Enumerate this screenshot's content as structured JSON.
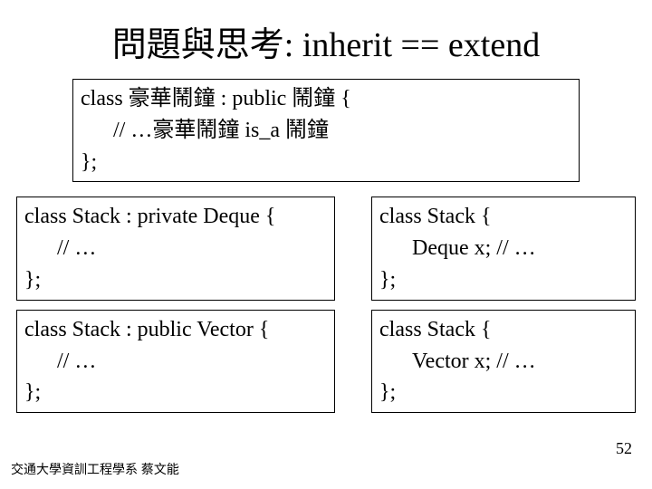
{
  "title": "問題與思考:  inherit == extend",
  "box1": {
    "l1": "class 豪華鬧鐘 : public 鬧鐘 {",
    "l2": "// …豪華鬧鐘   is_a 鬧鐘",
    "l3": "};"
  },
  "box2": {
    "l1": "class Stack : private Deque {",
    "l2": "// …",
    "l3": "};"
  },
  "box3": {
    "l1": "class Stack : public Vector {",
    "l2": "// …",
    "l3": "};"
  },
  "box4": {
    "l1": "class Stack {",
    "l2": "Deque x;  // …",
    "l3": "};"
  },
  "box5": {
    "l1": "class Stack {",
    "l2": "Vector x;  // …",
    "l3": "};"
  },
  "footer": "交通大學資訓工程學系 蔡文能",
  "page": "52"
}
